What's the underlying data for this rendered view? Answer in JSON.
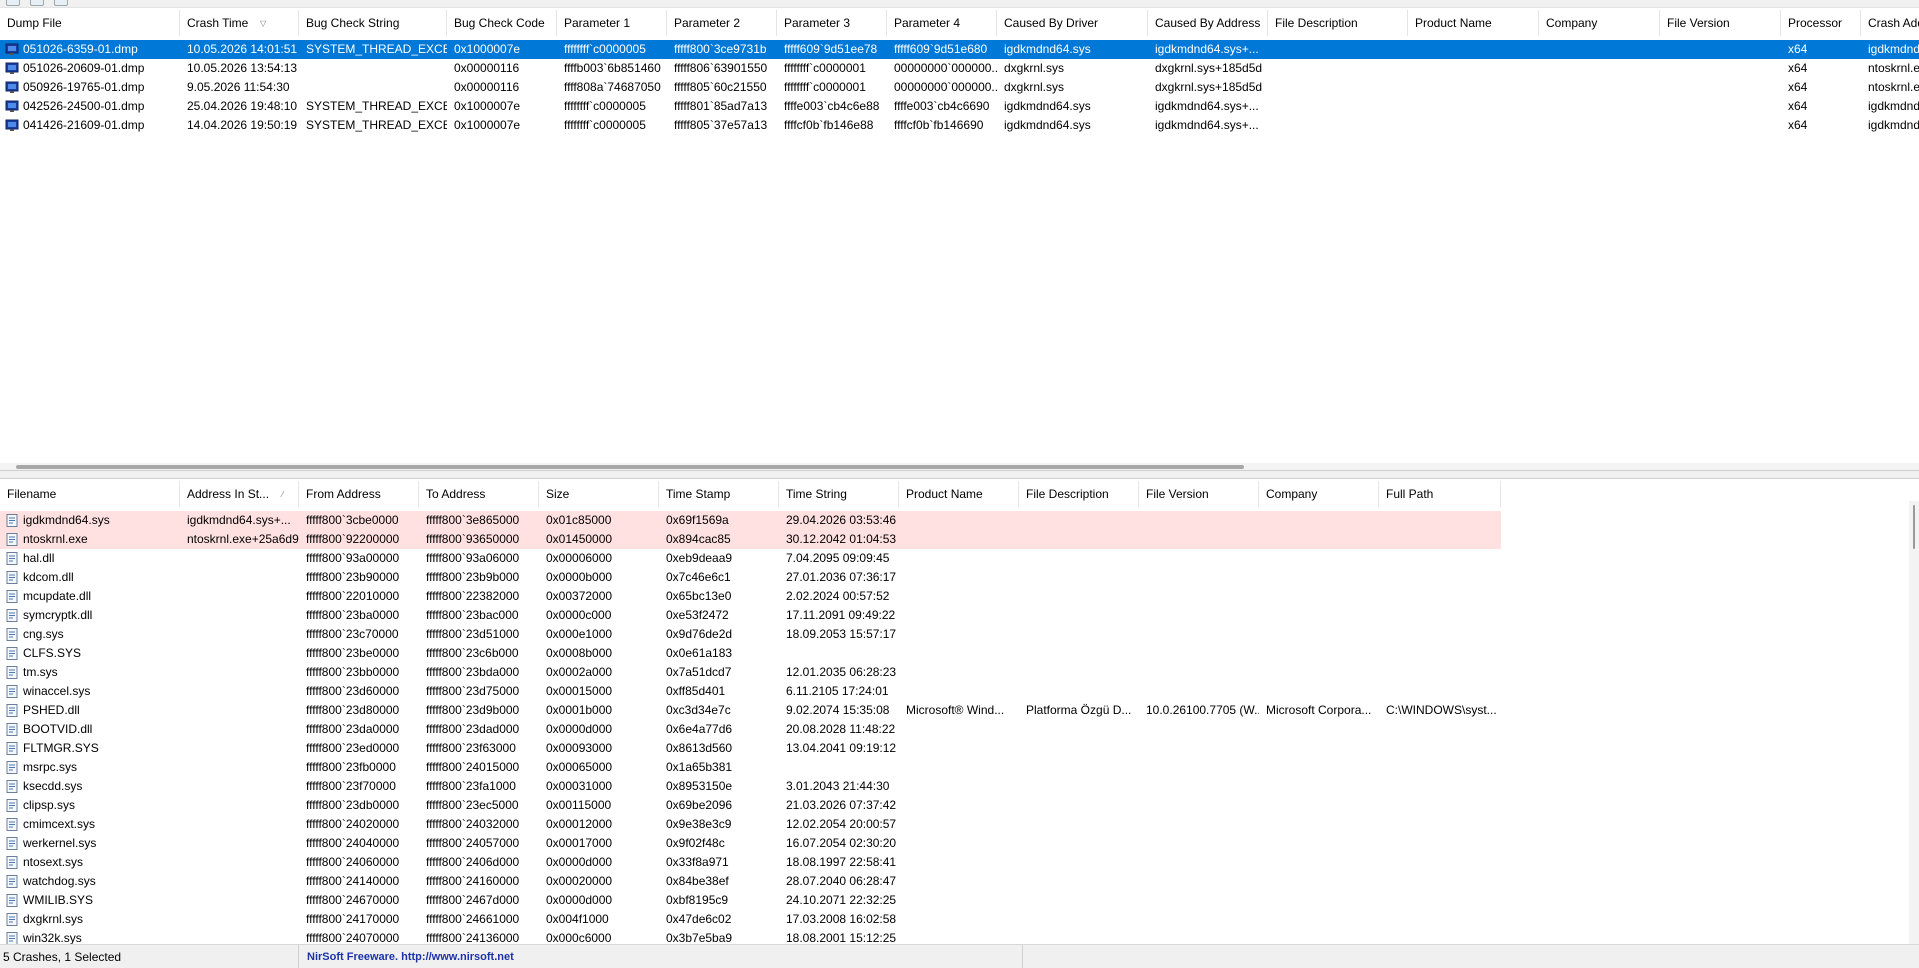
{
  "crash_list": {
    "columns": [
      "Dump File",
      "Crash Time",
      "Bug Check String",
      "Bug Check Code",
      "Parameter 1",
      "Parameter 2",
      "Parameter 3",
      "Parameter 4",
      "Caused By Driver",
      "Caused By Address",
      "File Description",
      "Product Name",
      "Company",
      "File Version",
      "Processor",
      "Crash Add"
    ],
    "sorted_column": "Crash Time",
    "rows": [
      {
        "dump_file": "051026-6359-01.dmp",
        "crash_time": "10.05.2026 14:01:51",
        "bug_check_string": "SYSTEM_THREAD_EXCE...",
        "bug_check_code": "0x1000007e",
        "param1": "ffffffff`c0000005",
        "param2": "fffff800`3ce9731b",
        "param3": "fffff609`9d51ee78",
        "param4": "fffff609`9d51e680",
        "caused_by_driver": "igdkmdnd64.sys",
        "caused_by_address": "igdkmdnd64.sys+...",
        "file_description": "",
        "product_name": "",
        "company": "",
        "file_version": "",
        "processor": "x64",
        "crash_address": "igdkmdnd",
        "selected": true
      },
      {
        "dump_file": "051026-20609-01.dmp",
        "crash_time": "10.05.2026 13:54:13",
        "bug_check_string": "",
        "bug_check_code": "0x00000116",
        "param1": "ffffb003`6b851460",
        "param2": "fffff806`63901550",
        "param3": "ffffffff`c0000001",
        "param4": "00000000`000000...",
        "caused_by_driver": "dxgkrnl.sys",
        "caused_by_address": "dxgkrnl.sys+185d5d",
        "file_description": "",
        "product_name": "",
        "company": "",
        "file_version": "",
        "processor": "x64",
        "crash_address": "ntoskrnl.e",
        "selected": false
      },
      {
        "dump_file": "050926-19765-01.dmp",
        "crash_time": "9.05.2026 11:54:30",
        "bug_check_string": "",
        "bug_check_code": "0x00000116",
        "param1": "ffff808a`74687050",
        "param2": "fffff805`60c21550",
        "param3": "ffffffff`c0000001",
        "param4": "00000000`000000...",
        "caused_by_driver": "dxgkrnl.sys",
        "caused_by_address": "dxgkrnl.sys+185d5d",
        "file_description": "",
        "product_name": "",
        "company": "",
        "file_version": "",
        "processor": "x64",
        "crash_address": "ntoskrnl.e",
        "selected": false
      },
      {
        "dump_file": "042526-24500-01.dmp",
        "crash_time": "25.04.2026 19:48:10",
        "bug_check_string": "SYSTEM_THREAD_EXCE...",
        "bug_check_code": "0x1000007e",
        "param1": "ffffffff`c0000005",
        "param2": "fffff801`85ad7a13",
        "param3": "ffffe003`cb4c6e88",
        "param4": "ffffe003`cb4c6690",
        "caused_by_driver": "igdkmdnd64.sys",
        "caused_by_address": "igdkmdnd64.sys+...",
        "file_description": "",
        "product_name": "",
        "company": "",
        "file_version": "",
        "processor": "x64",
        "crash_address": "igdkmdnd",
        "selected": false
      },
      {
        "dump_file": "041426-21609-01.dmp",
        "crash_time": "14.04.2026 19:50:19",
        "bug_check_string": "SYSTEM_THREAD_EXCE...",
        "bug_check_code": "0x1000007e",
        "param1": "ffffffff`c0000005",
        "param2": "fffff805`37e57a13",
        "param3": "ffffcf0b`fb146e88",
        "param4": "ffffcf0b`fb146690",
        "caused_by_driver": "igdkmdnd64.sys",
        "caused_by_address": "igdkmdnd64.sys+...",
        "file_description": "",
        "product_name": "",
        "company": "",
        "file_version": "",
        "processor": "x64",
        "crash_address": "igdkmdnd",
        "selected": false
      }
    ]
  },
  "module_list": {
    "columns": [
      "Filename",
      "Address In St...",
      "From Address",
      "To Address",
      "Size",
      "Time Stamp",
      "Time String",
      "Product Name",
      "File Description",
      "File Version",
      "Company",
      "Full Path"
    ],
    "sorted_column": "Address In St...",
    "rows": [
      {
        "filename": "igdkmdnd64.sys",
        "address_in_stack": "igdkmdnd64.sys+...",
        "from": "fffff800`3cbe0000",
        "to": "fffff800`3e865000",
        "size": "0x01c85000",
        "timestamp": "0x69f1569a",
        "time_string": "29.04.2026 03:53:46",
        "product_name": "",
        "file_description": "",
        "file_version": "",
        "company": "",
        "full_path": "",
        "highlight": true
      },
      {
        "filename": "ntoskrnl.exe",
        "address_in_stack": "ntoskrnl.exe+25a6d9",
        "from": "fffff800`92200000",
        "to": "fffff800`93650000",
        "size": "0x01450000",
        "timestamp": "0x894cac85",
        "time_string": "30.12.2042 01:04:53",
        "product_name": "",
        "file_description": "",
        "file_version": "",
        "company": "",
        "full_path": "",
        "highlight": true
      },
      {
        "filename": "hal.dll",
        "address_in_stack": "",
        "from": "fffff800`93a00000",
        "to": "fffff800`93a06000",
        "size": "0x00006000",
        "timestamp": "0xeb9deaa9",
        "time_string": "7.04.2095 09:09:45",
        "product_name": "",
        "file_description": "",
        "file_version": "",
        "company": "",
        "full_path": ""
      },
      {
        "filename": "kdcom.dll",
        "address_in_stack": "",
        "from": "fffff800`23b90000",
        "to": "fffff800`23b9b000",
        "size": "0x0000b000",
        "timestamp": "0x7c46e6c1",
        "time_string": "27.01.2036 07:36:17",
        "product_name": "",
        "file_description": "",
        "file_version": "",
        "company": "",
        "full_path": ""
      },
      {
        "filename": "mcupdate.dll",
        "address_in_stack": "",
        "from": "fffff800`22010000",
        "to": "fffff800`22382000",
        "size": "0x00372000",
        "timestamp": "0x65bc13e0",
        "time_string": "2.02.2024 00:57:52",
        "product_name": "",
        "file_description": "",
        "file_version": "",
        "company": "",
        "full_path": ""
      },
      {
        "filename": "symcryptk.dll",
        "address_in_stack": "",
        "from": "fffff800`23ba0000",
        "to": "fffff800`23bac000",
        "size": "0x0000c000",
        "timestamp": "0xe53f2472",
        "time_string": "17.11.2091 09:49:22",
        "product_name": "",
        "file_description": "",
        "file_version": "",
        "company": "",
        "full_path": ""
      },
      {
        "filename": "cng.sys",
        "address_in_stack": "",
        "from": "fffff800`23c70000",
        "to": "fffff800`23d51000",
        "size": "0x000e1000",
        "timestamp": "0x9d76de2d",
        "time_string": "18.09.2053 15:57:17",
        "product_name": "",
        "file_description": "",
        "file_version": "",
        "company": "",
        "full_path": ""
      },
      {
        "filename": "CLFS.SYS",
        "address_in_stack": "",
        "from": "fffff800`23be0000",
        "to": "fffff800`23c6b000",
        "size": "0x0008b000",
        "timestamp": "0x0e61a183",
        "time_string": "",
        "product_name": "",
        "file_description": "",
        "file_version": "",
        "company": "",
        "full_path": ""
      },
      {
        "filename": "tm.sys",
        "address_in_stack": "",
        "from": "fffff800`23bb0000",
        "to": "fffff800`23bda000",
        "size": "0x0002a000",
        "timestamp": "0x7a51dcd7",
        "time_string": "12.01.2035 06:28:23",
        "product_name": "",
        "file_description": "",
        "file_version": "",
        "company": "",
        "full_path": ""
      },
      {
        "filename": "winaccel.sys",
        "address_in_stack": "",
        "from": "fffff800`23d60000",
        "to": "fffff800`23d75000",
        "size": "0x00015000",
        "timestamp": "0xff85d401",
        "time_string": "6.11.2105 17:24:01",
        "product_name": "",
        "file_description": "",
        "file_version": "",
        "company": "",
        "full_path": ""
      },
      {
        "filename": "PSHED.dll",
        "address_in_stack": "",
        "from": "fffff800`23d80000",
        "to": "fffff800`23d9b000",
        "size": "0x0001b000",
        "timestamp": "0xc3d34e7c",
        "time_string": "9.02.2074 15:35:08",
        "product_name": "Microsoft® Wind...",
        "file_description": "Platforma Özgü D...",
        "file_version": "10.0.26100.7705 (W...",
        "company": "Microsoft Corpora...",
        "full_path": "C:\\WINDOWS\\syst..."
      },
      {
        "filename": "BOOTVID.dll",
        "address_in_stack": "",
        "from": "fffff800`23da0000",
        "to": "fffff800`23dad000",
        "size": "0x0000d000",
        "timestamp": "0x6e4a77d6",
        "time_string": "20.08.2028 11:48:22",
        "product_name": "",
        "file_description": "",
        "file_version": "",
        "company": "",
        "full_path": ""
      },
      {
        "filename": "FLTMGR.SYS",
        "address_in_stack": "",
        "from": "fffff800`23ed0000",
        "to": "fffff800`23f63000",
        "size": "0x00093000",
        "timestamp": "0x8613d560",
        "time_string": "13.04.2041 09:19:12",
        "product_name": "",
        "file_description": "",
        "file_version": "",
        "company": "",
        "full_path": ""
      },
      {
        "filename": "msrpc.sys",
        "address_in_stack": "",
        "from": "fffff800`23fb0000",
        "to": "fffff800`24015000",
        "size": "0x00065000",
        "timestamp": "0x1a65b381",
        "time_string": "",
        "product_name": "",
        "file_description": "",
        "file_version": "",
        "company": "",
        "full_path": ""
      },
      {
        "filename": "ksecdd.sys",
        "address_in_stack": "",
        "from": "fffff800`23f70000",
        "to": "fffff800`23fa1000",
        "size": "0x00031000",
        "timestamp": "0x8953150e",
        "time_string": "3.01.2043 21:44:30",
        "product_name": "",
        "file_description": "",
        "file_version": "",
        "company": "",
        "full_path": ""
      },
      {
        "filename": "clipsp.sys",
        "address_in_stack": "",
        "from": "fffff800`23db0000",
        "to": "fffff800`23ec5000",
        "size": "0x00115000",
        "timestamp": "0x69be2096",
        "time_string": "21.03.2026 07:37:42",
        "product_name": "",
        "file_description": "",
        "file_version": "",
        "company": "",
        "full_path": ""
      },
      {
        "filename": "cmimcext.sys",
        "address_in_stack": "",
        "from": "fffff800`24020000",
        "to": "fffff800`24032000",
        "size": "0x00012000",
        "timestamp": "0x9e38e3c9",
        "time_string": "12.02.2054 20:00:57",
        "product_name": "",
        "file_description": "",
        "file_version": "",
        "company": "",
        "full_path": ""
      },
      {
        "filename": "werkernel.sys",
        "address_in_stack": "",
        "from": "fffff800`24040000",
        "to": "fffff800`24057000",
        "size": "0x00017000",
        "timestamp": "0x9f02f48c",
        "time_string": "16.07.2054 02:30:20",
        "product_name": "",
        "file_description": "",
        "file_version": "",
        "company": "",
        "full_path": ""
      },
      {
        "filename": "ntosext.sys",
        "address_in_stack": "",
        "from": "fffff800`24060000",
        "to": "fffff800`2406d000",
        "size": "0x0000d000",
        "timestamp": "0x33f8a971",
        "time_string": "18.08.1997 22:58:41",
        "product_name": "",
        "file_description": "",
        "file_version": "",
        "company": "",
        "full_path": ""
      },
      {
        "filename": "watchdog.sys",
        "address_in_stack": "",
        "from": "fffff800`24140000",
        "to": "fffff800`24160000",
        "size": "0x00020000",
        "timestamp": "0x84be38ef",
        "time_string": "28.07.2040 06:28:47",
        "product_name": "",
        "file_description": "",
        "file_version": "",
        "company": "",
        "full_path": ""
      },
      {
        "filename": "WMILIB.SYS",
        "address_in_stack": "",
        "from": "fffff800`24670000",
        "to": "fffff800`2467d000",
        "size": "0x0000d000",
        "timestamp": "0xbf8195c9",
        "time_string": "24.10.2071 22:32:25",
        "product_name": "",
        "file_description": "",
        "file_version": "",
        "company": "",
        "full_path": ""
      },
      {
        "filename": "dxgkrnl.sys",
        "address_in_stack": "",
        "from": "fffff800`24170000",
        "to": "fffff800`24661000",
        "size": "0x004f1000",
        "timestamp": "0x47de6c02",
        "time_string": "17.03.2008 16:02:58",
        "product_name": "",
        "file_description": "",
        "file_version": "",
        "company": "",
        "full_path": ""
      },
      {
        "filename": "win32k.sys",
        "address_in_stack": "",
        "from": "fffff800`24070000",
        "to": "fffff800`24136000",
        "size": "0x000c6000",
        "timestamp": "0x3b7e5ba9",
        "time_string": "18.08.2001 15:12:25",
        "product_name": "",
        "file_description": "",
        "file_version": "",
        "company": "",
        "full_path": ""
      }
    ]
  },
  "status": {
    "summary": "5 Crashes, 1 Selected",
    "link_text": "NirSoft Freeware.  http://www.nirsoft.net"
  },
  "colors": {
    "selection": "#0078d7",
    "highlight_row": "#ffe1e1",
    "link": "#1c33a8"
  },
  "icons": {
    "dump_row": "computer-monitor-icon",
    "module_row": "module-file-icon",
    "sort_indicator": "sort-arrow-icon"
  }
}
